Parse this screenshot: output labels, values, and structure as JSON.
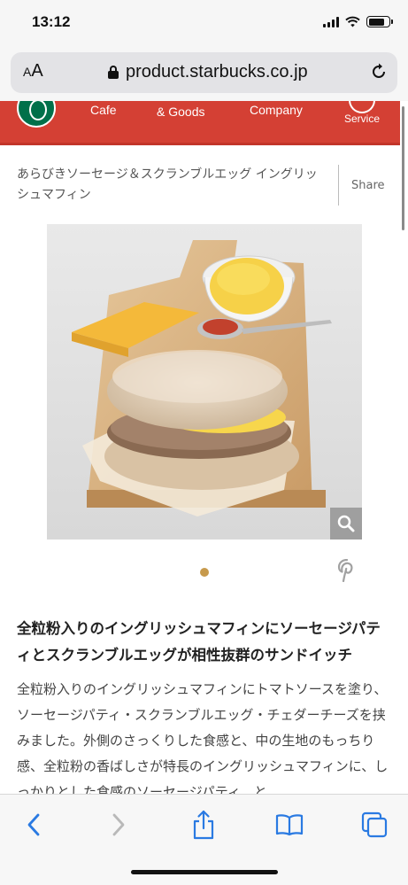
{
  "status_bar": {
    "time": "13:12"
  },
  "browser": {
    "aa_label": "AA",
    "url": "product.starbucks.co.jp"
  },
  "site_nav": {
    "items": [
      {
        "label": "Cafe"
      },
      {
        "label": "Coffee\n& Goods"
      },
      {
        "label": "Company"
      },
      {
        "label": "Service"
      }
    ]
  },
  "product": {
    "breadcrumb": "あらびきソーセージ＆スクランブルエッグ イングリッシュマフィン",
    "share_label": "Share",
    "headline": "全粒粉入りのイングリッシュマフィンにソーセージパティとスクランブルエッグが相性抜群のサンドイッチ",
    "description": "全粒粉入りのイングリッシュマフィンにトマトソースを塗り、ソーセージパティ・スクランブルエッグ・チェダーチーズを挟みました。外側のさっくりした食感と、中の生地のもっちり感、全粒粉の香ばしさが特長のイングリッシュマフィンに、しっかりとした食感のソーセージパティ、と"
  },
  "colors": {
    "nav_red": "#d44034",
    "starbucks_green": "#00704a",
    "pager_active": "#c79a4c",
    "ios_blue": "#2a7ae2"
  },
  "icons": {
    "lock": "lock-icon",
    "reload": "reload-icon",
    "zoom": "magnifier-icon",
    "pinterest": "pinterest-icon",
    "back": "chevron-left-icon",
    "forward": "chevron-right-icon",
    "share": "share-icon",
    "bookmarks": "book-icon",
    "tabs": "tabs-icon"
  }
}
